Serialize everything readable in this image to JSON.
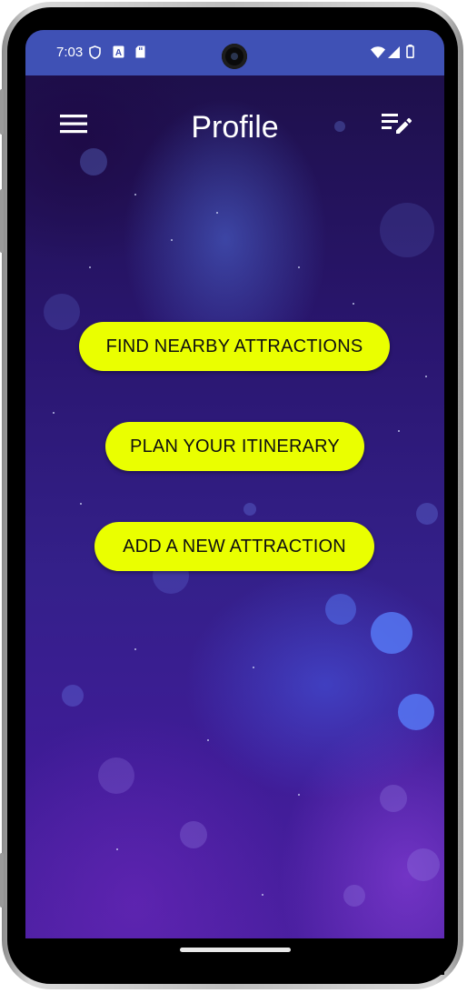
{
  "status_bar": {
    "time": "7:03",
    "left_icons": [
      "shield-icon",
      "a-badge-icon",
      "sd-card-icon"
    ],
    "right_icons": [
      "wifi-icon",
      "cell-signal-icon",
      "battery-icon"
    ],
    "color": "#3f51b5"
  },
  "toolbar": {
    "title": "Profile",
    "menu_icon": "hamburger-menu-icon",
    "edit_icon": "edit-list-icon"
  },
  "actions": {
    "find_nearby": "FIND NEARBY ATTRACTIONS",
    "plan_itinerary": "PLAN YOUR ITINERARY",
    "add_attraction": "ADD A NEW ATTRACTION"
  },
  "colors": {
    "button_bg": "#eaff00",
    "button_text": "#101010",
    "background_primary": "#2a1670",
    "background_accent": "#4a1fa0"
  }
}
